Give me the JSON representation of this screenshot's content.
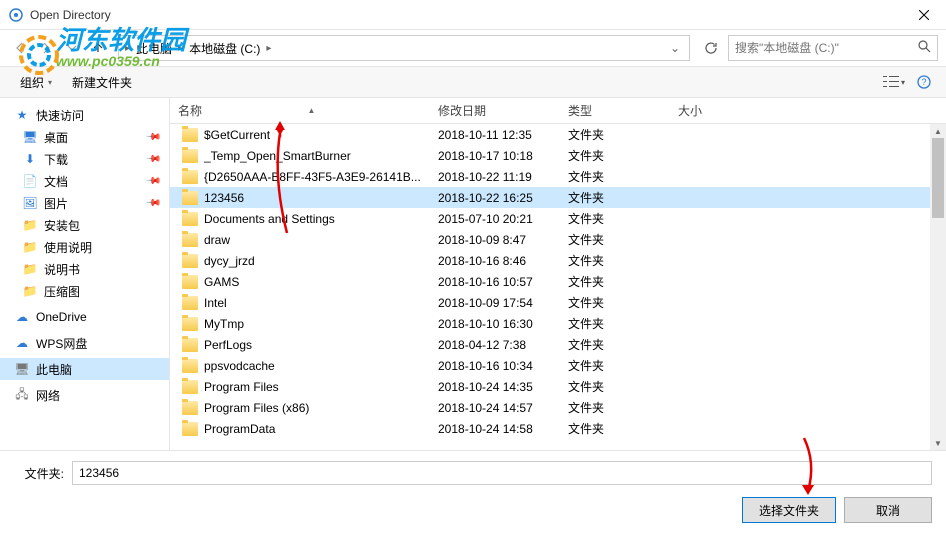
{
  "window": {
    "title": "Open Directory"
  },
  "breadcrumb": {
    "pc": "此电脑",
    "drive": "本地磁盘 (C:)"
  },
  "search": {
    "placeholder": "搜索\"本地磁盘 (C:)\""
  },
  "toolbar": {
    "organize": "组织",
    "newfolder": "新建文件夹"
  },
  "sidebar": {
    "quickaccess": "快速访问",
    "items": [
      {
        "label": "桌面",
        "pin": true,
        "glyph": "🖥",
        "cls": "ic-blue"
      },
      {
        "label": "下载",
        "pin": true,
        "glyph": "⬇",
        "cls": "ic-blue"
      },
      {
        "label": "文档",
        "pin": true,
        "glyph": "📄",
        "cls": "ic-blue"
      },
      {
        "label": "图片",
        "pin": true,
        "glyph": "🖼",
        "cls": "ic-blue"
      },
      {
        "label": "安装包",
        "pin": false,
        "glyph": "📁",
        "cls": "ic-orange"
      },
      {
        "label": "使用说明",
        "pin": false,
        "glyph": "📁",
        "cls": "ic-orange"
      },
      {
        "label": "说明书",
        "pin": false,
        "glyph": "📁",
        "cls": "ic-orange"
      },
      {
        "label": "压缩图",
        "pin": false,
        "glyph": "📁",
        "cls": "ic-orange"
      }
    ],
    "onedrive": "OneDrive",
    "wps": "WPS网盘",
    "thispc": "此电脑",
    "network": "网络"
  },
  "columns": {
    "name": "名称",
    "date": "修改日期",
    "type": "类型",
    "size": "大小"
  },
  "rows": [
    {
      "name": "$GetCurrent",
      "date": "2018-10-11 12:35",
      "type": "文件夹",
      "sel": false
    },
    {
      "name": "_Temp_Open_SmartBurner",
      "date": "2018-10-17 10:18",
      "type": "文件夹",
      "sel": false
    },
    {
      "name": "{D2650AAA-B8FF-43F5-A3E9-26141B...",
      "date": "2018-10-22 11:19",
      "type": "文件夹",
      "sel": false
    },
    {
      "name": "123456",
      "date": "2018-10-22 16:25",
      "type": "文件夹",
      "sel": true
    },
    {
      "name": "Documents and Settings",
      "date": "2015-07-10 20:21",
      "type": "文件夹",
      "sel": false
    },
    {
      "name": "draw",
      "date": "2018-10-09 8:47",
      "type": "文件夹",
      "sel": false
    },
    {
      "name": "dycy_jrzd",
      "date": "2018-10-16 8:46",
      "type": "文件夹",
      "sel": false
    },
    {
      "name": "GAMS",
      "date": "2018-10-16 10:57",
      "type": "文件夹",
      "sel": false
    },
    {
      "name": "Intel",
      "date": "2018-10-09 17:54",
      "type": "文件夹",
      "sel": false
    },
    {
      "name": "MyTmp",
      "date": "2018-10-10 16:30",
      "type": "文件夹",
      "sel": false
    },
    {
      "name": "PerfLogs",
      "date": "2018-04-12 7:38",
      "type": "文件夹",
      "sel": false
    },
    {
      "name": "ppsvodcache",
      "date": "2018-10-16 10:34",
      "type": "文件夹",
      "sel": false
    },
    {
      "name": "Program Files",
      "date": "2018-10-24 14:35",
      "type": "文件夹",
      "sel": false
    },
    {
      "name": "Program Files (x86)",
      "date": "2018-10-24 14:57",
      "type": "文件夹",
      "sel": false
    },
    {
      "name": "ProgramData",
      "date": "2018-10-24 14:58",
      "type": "文件夹",
      "sel": false
    }
  ],
  "bottom": {
    "folder_label": "文件夹:",
    "folder_value": "123456",
    "select_btn": "选择文件夹",
    "cancel_btn": "取消"
  },
  "watermark": {
    "text": "河东软件园",
    "url": "www.pc0359.cn"
  }
}
